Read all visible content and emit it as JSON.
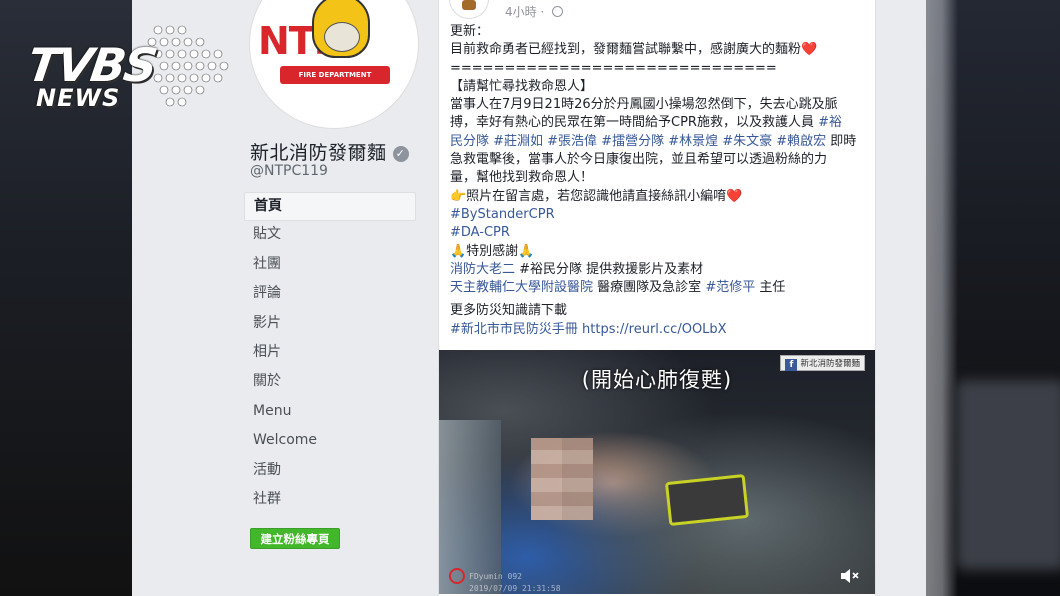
{
  "watermark": {
    "word": "TVBS",
    "sub": "NEWS"
  },
  "page": {
    "avatar_text": "NTFD",
    "avatar_ribbon": "FIRE DEPARTMENT",
    "name": "新北消防發爾麵",
    "handle": "@NTPC119"
  },
  "nav": {
    "items": [
      {
        "label": "首頁",
        "active": true
      },
      {
        "label": "貼文"
      },
      {
        "label": "社團"
      },
      {
        "label": "評論"
      },
      {
        "label": "影片"
      },
      {
        "label": "相片"
      },
      {
        "label": "關於"
      },
      {
        "label": "Menu"
      },
      {
        "label": "Welcome"
      },
      {
        "label": "活動"
      },
      {
        "label": "社群"
      }
    ],
    "create_button": "建立粉絲專頁"
  },
  "post": {
    "time": "4小時",
    "lines": {
      "l1": "更新：",
      "l2a": "目前救命勇者已經找到，發爾麵嘗試聯繫中，感謝廣大的麵粉",
      "l3": "==============================",
      "l4": "【請幫忙尋找救命恩人】",
      "l5": "當事人在7月9日21時26分於丹鳳國小操場忽然倒下，失去心跳及脈",
      "l6a": "搏，幸好有熱心的民眾在第一時間給予CPR施救，以及救護人員",
      "l6tag": "#裕",
      "l7tags": "民分隊 #莊淵如 #張浩偉 #擂營分隊 #林景煌 #朱文豪 #賴啟宏",
      "l7b": "即時",
      "l8": "急救電擊後，當事人於今日康復出院，並且希望可以透過粉絲的力",
      "l9": "量，幫他找到救命恩人！",
      "l10": "👉照片在留言處，若您認識他請直接絲訊小編唷",
      "l11": "#ByStanderCPR",
      "l12": "#DA-CPR",
      "l13": "🙏特別感謝🙏",
      "l14tag": "消防大老二",
      "l14b": "#裕民分隊 提供救援影片及素材",
      "l15tag": "天主教輔仁大學附設醫院",
      "l15b": "醫療團隊及急診室",
      "l15tag2": "#范修平",
      "l15c": "主任",
      "l16": "更多防災知識請下載",
      "l17tag": "#新北市市民防災手冊",
      "l17url": "https://reurl.cc/OOLbX"
    },
    "heart": "❤️",
    "video": {
      "caption": "(開始心肺復甦)",
      "badge": "新北消防發爾麵",
      "stamp_line1": "FDyumin 092",
      "stamp_line2": "2019/07/09 21:31:58"
    }
  },
  "icons": [
    "verified-icon",
    "globe-icon",
    "facebook-icon",
    "mute-icon"
  ]
}
